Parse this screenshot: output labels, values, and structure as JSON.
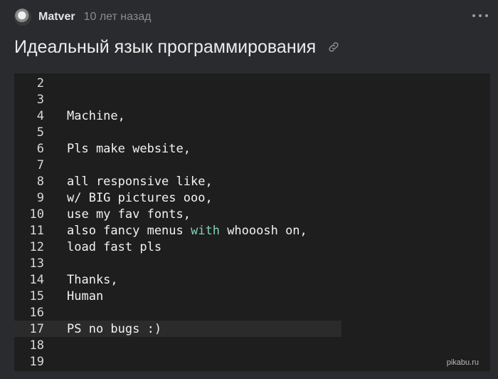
{
  "post": {
    "author": "Matver",
    "time": "10 лет назад",
    "title": "Идеальный язык программирования",
    "more_icon": "more-horizontal-icon",
    "link_icon": "link-icon"
  },
  "code": {
    "lines": [
      {
        "n": "2",
        "text": ""
      },
      {
        "n": "3",
        "text": ""
      },
      {
        "n": "4",
        "text": "Machine,"
      },
      {
        "n": "5",
        "text": ""
      },
      {
        "n": "6",
        "text": "Pls make website,"
      },
      {
        "n": "7",
        "text": ""
      },
      {
        "n": "8",
        "text": "all responsive like,"
      },
      {
        "n": "9",
        "text": "w/ BIG pictures ooo,"
      },
      {
        "n": "10",
        "text": "use my fav fonts,"
      },
      {
        "n": "11",
        "pre": "also fancy menus ",
        "kw": "with",
        "post": " whooosh on,"
      },
      {
        "n": "12",
        "text": "load fast pls"
      },
      {
        "n": "13",
        "text": ""
      },
      {
        "n": "14",
        "text": "Thanks,"
      },
      {
        "n": "15",
        "text": "Human"
      },
      {
        "n": "16",
        "text": ""
      },
      {
        "n": "17",
        "text": "PS no bugs :)"
      },
      {
        "n": "18",
        "text": ""
      },
      {
        "n": "19",
        "text": ""
      }
    ],
    "current_line": "17",
    "keyword_color": "#7fd1b9"
  },
  "watermark": "pikabu.ru"
}
